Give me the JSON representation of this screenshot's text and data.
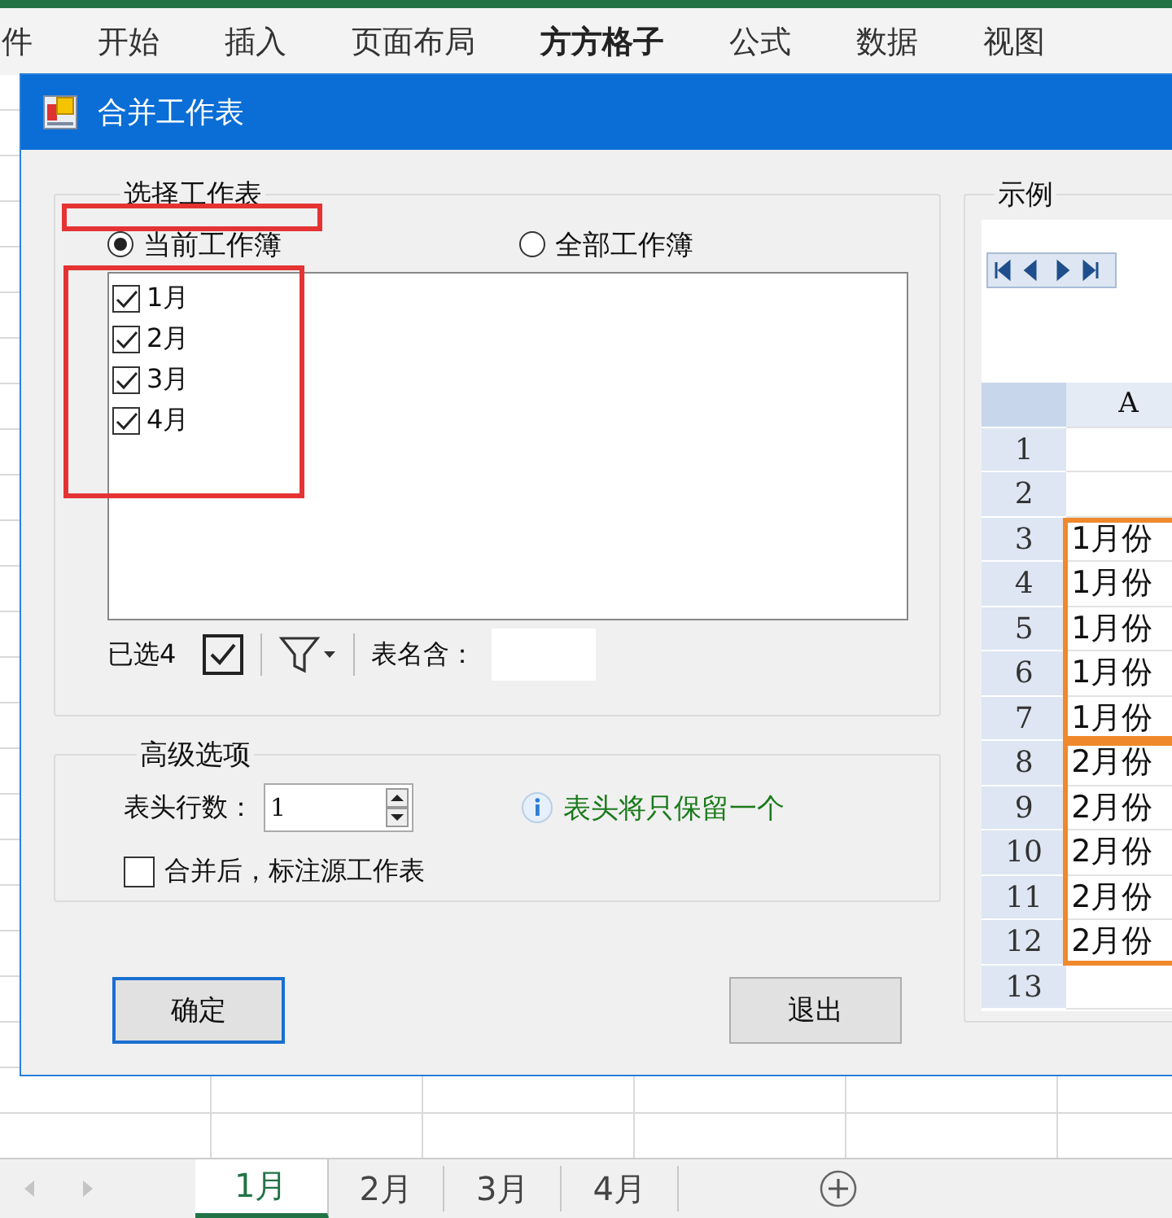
{
  "ribbon": {
    "tabs": [
      {
        "label": "件",
        "selected": false
      },
      {
        "label": "开始",
        "selected": false
      },
      {
        "label": "插入",
        "selected": false
      },
      {
        "label": "页面布局",
        "selected": false
      },
      {
        "label": "方方格子",
        "selected": true
      },
      {
        "label": "公式",
        "selected": false
      },
      {
        "label": "数据",
        "selected": false
      },
      {
        "label": "视图",
        "selected": false
      }
    ]
  },
  "dialog": {
    "title": "合并工作表",
    "select_group": {
      "title": "选择工作表",
      "highlighted": true,
      "scopes": [
        {
          "label": "当前工作簿",
          "selected": true
        },
        {
          "label": "全部工作簿",
          "selected": false
        }
      ],
      "sheets_highlighted": true,
      "sheets": [
        {
          "label": "1月",
          "checked": true
        },
        {
          "label": "2月",
          "checked": true
        },
        {
          "label": "3月",
          "checked": true
        },
        {
          "label": "4月",
          "checked": true
        }
      ],
      "selected_count": "已选4",
      "name_filter_label": "表名含："
    },
    "advanced": {
      "title": "高级选项",
      "header_rows_label": "表头行数：",
      "header_rows": "1",
      "hint": "表头将只保留一个",
      "mark_source": {
        "label": "合并后，标注源工作表",
        "checked": false
      }
    },
    "buttons": [
      {
        "label": "确定",
        "kind": "default"
      },
      {
        "label": "退出",
        "kind": "normal"
      }
    ],
    "example": {
      "title": "示例",
      "column": "A",
      "rows": [
        {
          "num": "1"
        },
        {
          "num": "2"
        }
      ],
      "blocks": [
        {
          "highlighted": true,
          "rows": [
            {
              "num": "3",
              "cell": "1月份"
            },
            {
              "num": "4",
              "cell": "1月份"
            },
            {
              "num": "5",
              "cell": "1月份"
            },
            {
              "num": "6",
              "cell": "1月份"
            },
            {
              "num": "7",
              "cell": "1月份"
            }
          ]
        },
        {
          "highlighted": true,
          "rows": [
            {
              "num": "8",
              "cell": "2月份"
            },
            {
              "num": "9",
              "cell": "2月份"
            },
            {
              "num": "10",
              "cell": "2月份"
            },
            {
              "num": "11",
              "cell": "2月份"
            },
            {
              "num": "12",
              "cell": "2月份"
            }
          ]
        }
      ],
      "rows_after": [
        {
          "num": "13"
        }
      ]
    }
  },
  "sheet_tabs": [
    {
      "label": "1月",
      "selected": true
    },
    {
      "label": "2月",
      "selected": false
    },
    {
      "label": "3月",
      "selected": false
    },
    {
      "label": "4月",
      "selected": false
    }
  ]
}
